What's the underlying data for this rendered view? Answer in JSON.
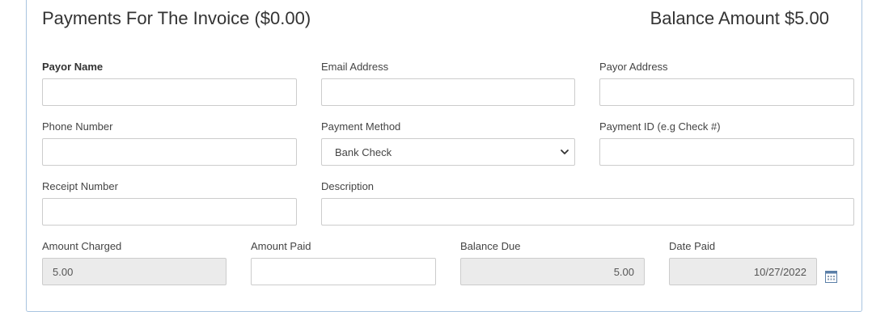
{
  "header": {
    "title": "Payments For The Invoice ($0.00)",
    "balance": "Balance Amount $5.00"
  },
  "form": {
    "payor_name": {
      "label": "Payor Name",
      "value": ""
    },
    "email": {
      "label": "Email Address",
      "value": ""
    },
    "payor_address": {
      "label": "Payor Address",
      "value": ""
    },
    "phone": {
      "label": "Phone Number",
      "value": ""
    },
    "payment_method": {
      "label": "Payment Method",
      "value": "Bank Check"
    },
    "payment_id": {
      "label": "Payment ID (e.g Check #)",
      "value": ""
    },
    "receipt_number": {
      "label": "Receipt Number",
      "value": ""
    },
    "description": {
      "label": "Description",
      "value": ""
    },
    "amount_charged": {
      "label": "Amount Charged",
      "value": "5.00"
    },
    "amount_paid": {
      "label": "Amount Paid",
      "value": ""
    },
    "balance_due": {
      "label": "Balance Due",
      "value": "5.00"
    },
    "date_paid": {
      "label": "Date Paid",
      "value": "10/27/2022"
    }
  },
  "icons": {
    "select_chevron": "chevron-down-icon",
    "date_picker": "calendar-icon"
  },
  "colors": {
    "panel_border": "#a9c4e0",
    "field_border": "#cccccc",
    "readonly_bg": "#ebebeb",
    "calendar_accent": "#5b7fa8"
  }
}
